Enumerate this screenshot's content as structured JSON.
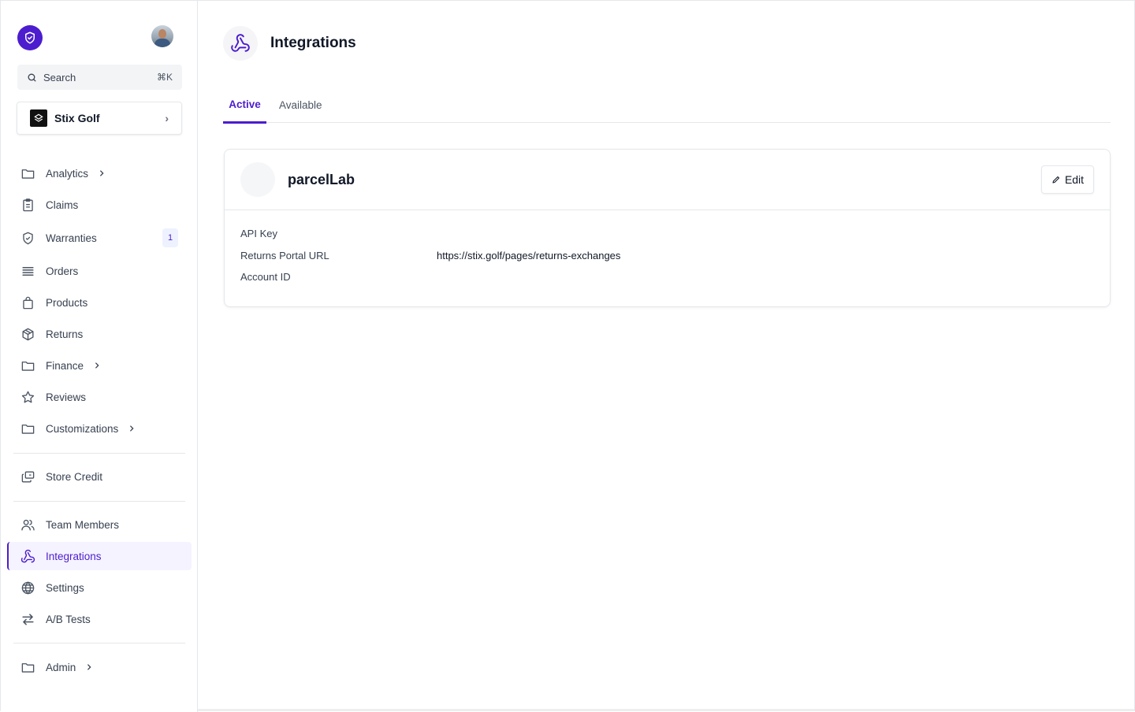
{
  "sidebar": {
    "search": {
      "label": "Search",
      "shortcut": "⌘K"
    },
    "store": {
      "name": "Stix Golf"
    },
    "items": [
      {
        "label": "Analytics",
        "icon": "folder-icon"
      },
      {
        "label": "Claims",
        "icon": "clipboard-icon"
      },
      {
        "label": "Warranties",
        "icon": "shield-check-icon",
        "badge": "1"
      },
      {
        "label": "Orders",
        "icon": "stack-icon"
      },
      {
        "label": "Products",
        "icon": "shopping-bag-icon"
      },
      {
        "label": "Returns",
        "icon": "box-icon"
      },
      {
        "label": "Finance",
        "icon": "folder-icon"
      },
      {
        "label": "Reviews",
        "icon": "star-icon"
      },
      {
        "label": "Customizations",
        "icon": "folder-icon"
      },
      {
        "label": "Store Credit",
        "icon": "credit-cards-icon"
      },
      {
        "label": "Team Members",
        "icon": "users-icon"
      },
      {
        "label": "Integrations",
        "icon": "webhook-icon"
      },
      {
        "label": "Settings",
        "icon": "globe-icon"
      },
      {
        "label": "A/B Tests",
        "icon": "arrows-swap-icon"
      },
      {
        "label": "Admin",
        "icon": "folder-icon"
      }
    ]
  },
  "page": {
    "title": "Integrations",
    "tabs": [
      {
        "label": "Active"
      },
      {
        "label": "Available"
      }
    ],
    "active_tab": "Active"
  },
  "integration": {
    "name": "parcelLab",
    "edit_label": "Edit",
    "fields": [
      {
        "label": "API Key",
        "value": ""
      },
      {
        "label": "Returns Portal URL",
        "value": "https://stix.golf/pages/returns-exchanges"
      },
      {
        "label": "Account ID",
        "value": ""
      }
    ]
  },
  "colors": {
    "accent": "#4c1dce",
    "active_bg": "#f5f3ff",
    "border": "#e5e7eb"
  }
}
